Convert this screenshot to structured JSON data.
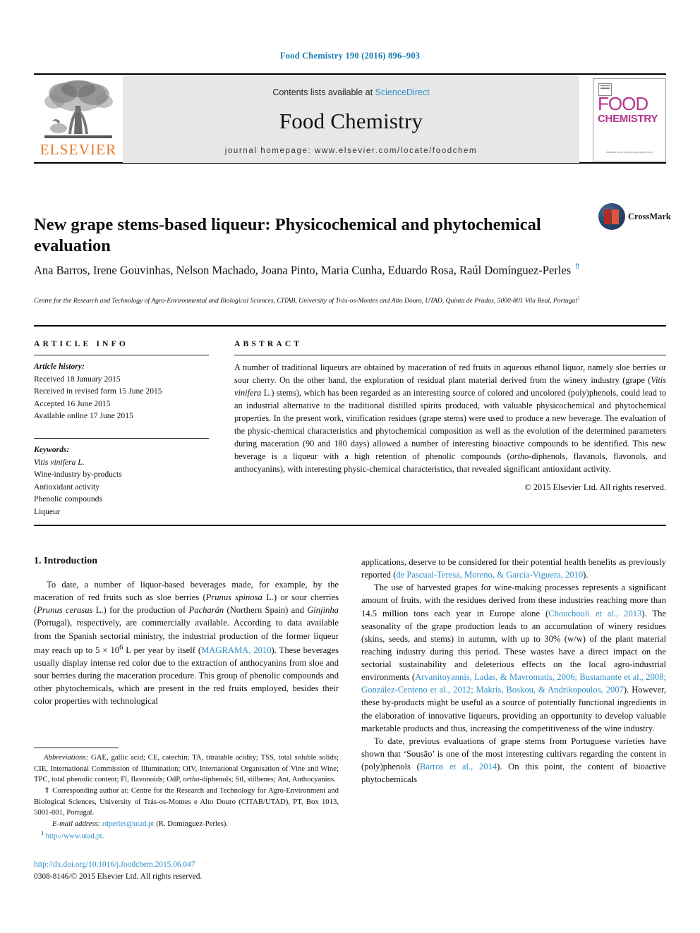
{
  "running_head": "Food Chemistry 190 (2016) 896–903",
  "masthead": {
    "publisher_name": "ELSEVIER",
    "contents_prefix": "Contents lists available at ",
    "contents_link": "ScienceDirect",
    "journal_name": "Food Chemistry",
    "homepage": "journal homepage: www.elsevier.com/locate/foodchem",
    "cover": {
      "line1": "FOOD",
      "line2": "CHEMISTRY",
      "footer": "Available online at www.sciencedirect.com"
    }
  },
  "article": {
    "title": "New grape stems-based liqueur: Physicochemical and phytochemical evaluation",
    "crossmark_label": "CrossMark",
    "authors": "Ana Barros, Irene Gouvinhas, Nelson Machado, Joana Pinto, Maria Cunha, Eduardo Rosa, Raúl Domínguez-Perles ",
    "affiliation": "Centre for the Research and Technology of Agro-Environmental and Biological Sciences, CITAB, University of Trás-os-Montes and Alto Douro, UTAD, Quinta de Prados, 5000-801 Vila Real, Portugal"
  },
  "article_info": {
    "heading": "ARTICLE INFO",
    "history_label": "Article history:",
    "history": [
      "Received 18 January 2015",
      "Received in revised form 15 June 2015",
      "Accepted 16 June 2015",
      "Available online 17 June 2015"
    ],
    "keywords_label": "Keywords:",
    "keywords": [
      "Vitis vinifera L.",
      "Wine-industry by-products",
      "Antioxidant activity",
      "Phenolic compounds",
      "Liqueur"
    ]
  },
  "abstract": {
    "heading": "ABSTRACT",
    "text_part1": "A number of traditional liqueurs are obtained by maceration of red fruits in aqueous ethanol liquor, namely sloe berries or sour cherry. On the other hand, the exploration of residual plant material derived from the winery industry (grape (",
    "species": "Vitis vinifera",
    "text_part2": " L.) stems), which has been regarded as an interesting source of colored and uncolored (poly)phenols, could lead to an industrial alternative to the traditional distilled spirits produced, with valuable physicochemical and phytochemical properties. In the present work, vinification residues (grape stems) were used to produce a new beverage. The evaluation of the physic-chemical characteristics and phytochemical composition as well as the evolution of the determined parameters during maceration (90 and 180 days) allowed a number of interesting bioactive compounds to be identified. This new beverage is a liqueur with a high retention of phenolic compounds (",
    "ortho": "ortho",
    "text_part3": "-diphenols, flavanols, flavonols, and anthocyanins), with interesting physic-chemical characteristics, that revealed significant antioxidant activity.",
    "rights": "© 2015 Elsevier Ltd. All rights reserved."
  },
  "introduction": {
    "heading": "1. Introduction",
    "left": {
      "p1_a": "To date, a number of liquor-based beverages made, for example, by the maceration of red fruits such as sloe berries (",
      "p1_sp1": "Prunus spinosa",
      "p1_b": " L.) or sour cherries (",
      "p1_sp2": "Prunus cerasus",
      "p1_c": " L.) for the production of ",
      "p1_sp3": "Pacharán",
      "p1_d": " (Northern Spain) and ",
      "p1_sp4": "Ginjinha",
      "p1_e": " (Portugal), respectively, are commercially available. According to data available from the Spanish sectorial ministry, the industrial production of the former liqueur may reach up to 5 × 10",
      "p1_exp": "6",
      "p1_f": " L per year by itself (",
      "p1_cite": "MAGRAMA, 2010",
      "p1_g": "). These beverages usually display intense red color due to the extraction of anthocyanins from sloe and sour berries during the maceration procedure. This group of phenolic compounds and other phytochemicals, which are present in the red fruits employed, besides their color properties with technological"
    },
    "right": {
      "p1_cont_a": "applications, deserve to be considered for their potential health benefits as previously reported (",
      "p1_cont_cite": "de Pascual-Teresa, Moreno, & García-Viguera, 2010",
      "p1_cont_b": ").",
      "p2_a": "The use of harvested grapes for wine-making processes represents a significant amount of fruits, with the residues derived from these industries reaching more than 14.5 million tons each year in Europe alone (",
      "p2_cite1": "Chouchouli et al., 2013",
      "p2_b": "). The seasonality of the grape production leads to an accumulation of winery residues (skins, seeds, and stems) in autumn, with up to 30% (w/w) of the plant material reaching industry during this period. These wastes have a direct impact on the sectorial sustainability and deleterious effects on the local agro-industrial environments (",
      "p2_cite2": "Arvanitoyannis, Ladas, & Mavromatis, 2006; Bustamante et al., 2008; González-Centeno et al., 2012; Makris, Boskou, & Andrikopoulos, 2007",
      "p2_c": "). However, these by-products might be useful as a source of potentially functional ingredients in the elaboration of innovative liqueurs, providing an opportunity to develop valuable marketable products and thus, increasing the competitiveness of the wine industry.",
      "p3_a": "To date, previous evaluations of grape stems from Portuguese varieties have shown that ‘Sousão’ is one of the most interesting cultivars regarding the content in (poly)phenols (",
      "p3_cite": "Barros et al., 2014",
      "p3_b": "). On this point, the content of bioactive phytochemicals"
    }
  },
  "footnotes": {
    "abbrev_label": "Abbreviations:",
    "abbrev_text": " GAE, gallic acid; CE, catechin; TA, titratable acidity; TSS, total soluble solids; CIE, International Commission of Illumination; OIV, International Organisation of Vine and Wine; TPC, total phenolic content; Fl, flavonoids; OdP, ",
    "abbrev_ortho": "ortho",
    "abbrev_tail": "-diphenols; Stl, stilbenes; Ant, Anthocyanins.",
    "corresponding": "⇑ Corresponding author at: Centre for the Research and Technology for Agro-Environment and Biological Sciences, University of Trás-os-Montes e Alto Douro (CITAB/UTAD), PT, Box 1013, 5001-801, Portugal.",
    "email_label": "E-mail address:",
    "email": "rdperles@utad.pt",
    "email_owner": " (R. Domínguez-Perles).",
    "url_marker": "1",
    "url": "http://www.utad.pt."
  },
  "imprint": {
    "doi": "http://dx.doi.org/10.1016/j.foodchem.2015.06.047",
    "issn": "0308-8146/© 2015 Elsevier Ltd. All rights reserved."
  }
}
